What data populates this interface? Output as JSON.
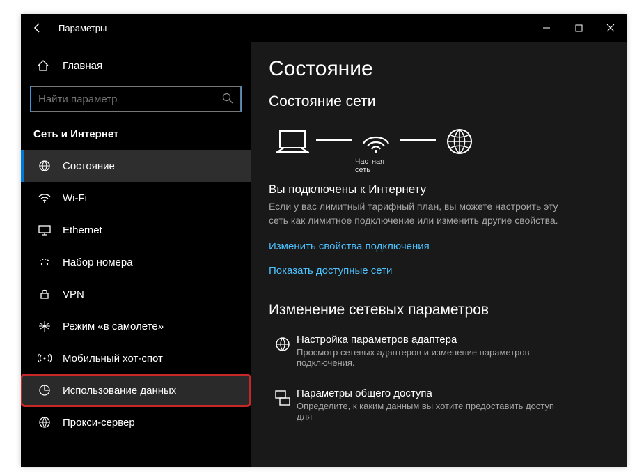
{
  "titlebar": {
    "title": "Параметры"
  },
  "sidebar": {
    "home": "Главная",
    "search_placeholder": "Найти параметр",
    "section": "Сеть и Интернет",
    "items": [
      {
        "label": "Состояние"
      },
      {
        "label": "Wi-Fi"
      },
      {
        "label": "Ethernet"
      },
      {
        "label": "Набор номера"
      },
      {
        "label": "VPN"
      },
      {
        "label": "Режим «в самолете»"
      },
      {
        "label": "Мобильный хот-спот"
      },
      {
        "label": "Использование данных"
      },
      {
        "label": "Прокси-сервер"
      }
    ]
  },
  "main": {
    "h1": "Состояние",
    "h2": "Состояние сети",
    "diagram_caption": "Частная сеть",
    "connected_title": "Вы подключены к Интернету",
    "connected_desc": "Если у вас лимитный тарифный план, вы можете настроить эту сеть как лимитное подключение или изменить другие свойства.",
    "link1": "Изменить свойства подключения",
    "link2": "Показать доступные сети",
    "section2_title": "Изменение сетевых параметров",
    "opt1_title": "Настройка параметров адаптера",
    "opt1_desc": "Просмотр сетевых адаптеров и изменение параметров подключения.",
    "opt2_title": "Параметры общего доступа",
    "opt2_desc": "Определите, к каким данным вы хотите предоставить доступ для"
  }
}
